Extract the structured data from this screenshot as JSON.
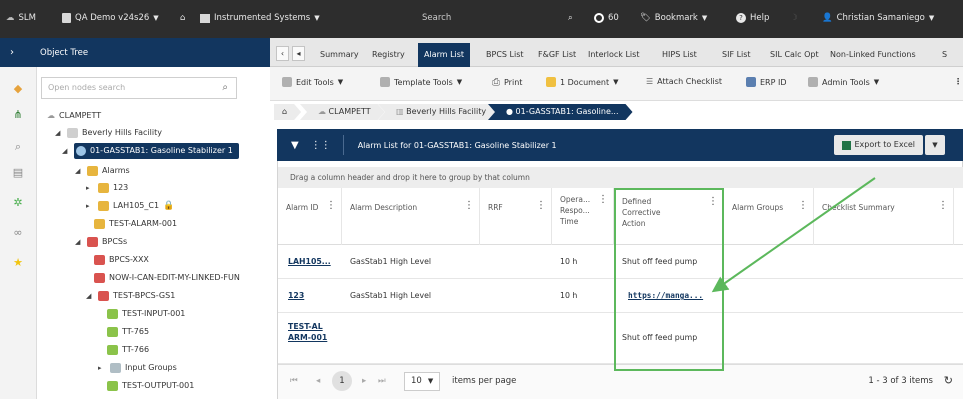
{
  "topbar": {
    "slm": "SLM",
    "project": "QA Demo v24s26",
    "system": "Instrumented Systems",
    "search": "Search",
    "count": "60",
    "bookmark": "Bookmark",
    "help": "Help",
    "user": "Christian Samaniego"
  },
  "sidebar": {
    "title": "Object Tree",
    "search_placeholder": "Open nodes search",
    "tree": [
      {
        "label": "CLAMPETT"
      },
      {
        "label": "Beverly Hills Facility"
      },
      {
        "label": "01-GASSTAB1: Gasoline Stabilizer 1"
      },
      {
        "label": "Alarms"
      },
      {
        "label": "123"
      },
      {
        "label": "LAH105_C1"
      },
      {
        "label": "TEST-ALARM-001"
      },
      {
        "label": "BPCSs"
      },
      {
        "label": "BPCS-XXX"
      },
      {
        "label": "NOW-I-CAN-EDIT-MY-LINKED-FUN"
      },
      {
        "label": "TEST-BPCS-GS1"
      },
      {
        "label": "TEST-INPUT-001"
      },
      {
        "label": "TT-765"
      },
      {
        "label": "TT-766"
      },
      {
        "label": "Input Groups"
      },
      {
        "label": "TEST-OUTPUT-001"
      }
    ]
  },
  "tabs": [
    "Summary",
    "Registry",
    "Alarm List",
    "BPCS List",
    "F&GF List",
    "Interlock List",
    "HIPS List",
    "SIF List",
    "SIL Calc Opt",
    "Non-Linked Functions",
    "S"
  ],
  "active_tab": "Alarm List",
  "toolbar": {
    "edit_tools": "Edit Tools",
    "template_tools": "Template Tools",
    "print": "Print",
    "document": "1 Document",
    "attach_checklist": "Attach Checklist",
    "erp_id": "ERP ID",
    "admin_tools": "Admin Tools"
  },
  "breadcrumb": [
    "CLAMPETT",
    "Beverly Hills Facility",
    "01-GASSTAB1: Gasoline..."
  ],
  "grid": {
    "title": "Alarm List for 01-GASSTAB1: Gasoline Stabilizer 1",
    "export": "Export to Excel",
    "group_hint": "Drag a column header and drop it here to group by that column",
    "columns": [
      {
        "label": "Alarm ID"
      },
      {
        "label": "Alarm Description"
      },
      {
        "label": "RRF"
      },
      {
        "label": "Opera... Respo... Time"
      },
      {
        "label": "Defined Corrective Action"
      },
      {
        "label": "Alarm Groups"
      },
      {
        "label": "Checklist Summary"
      }
    ],
    "rows": [
      {
        "id": "LAH105...",
        "desc": "GasStab1 High Level",
        "rrf": "",
        "time": "10 h",
        "action": "Shut off feed pump"
      },
      {
        "id": "123",
        "desc": "GasStab1 High Level",
        "rrf": "",
        "time": "10 h",
        "action": "https://manga..."
      },
      {
        "id": "TEST-ALARM-001",
        "desc": "",
        "rrf": "",
        "time": "",
        "action": "Shut off feed pump"
      }
    ],
    "pager": {
      "page": "1",
      "page_size": "10",
      "per_page_label": "items per page",
      "summary": "1 - 3 of 3 items"
    }
  },
  "colors": {
    "navy": "#12365f",
    "highlight": "#5cb85c",
    "topbar": "#2d2d2d"
  }
}
